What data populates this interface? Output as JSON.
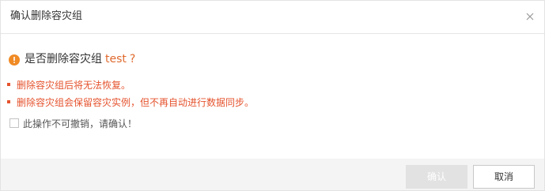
{
  "dialog": {
    "title": "确认删除容灾组",
    "close_icon": "close-icon"
  },
  "question": {
    "icon": "warning-icon",
    "prefix": "是否删除容灾组",
    "name": "test",
    "suffix": "?"
  },
  "warnings": [
    "删除容灾组后将无法恢复。",
    "删除容灾组会保留容灾实例，但不再自动进行数据同步。"
  ],
  "confirm": {
    "label": "此操作不可撤销，请确认！",
    "checked": false
  },
  "buttons": {
    "ok_label": "确认",
    "cancel_label": "取消"
  },
  "colors": {
    "warning": "#e5532e",
    "accent": "#e06a2f",
    "disabled_button": "#e2e2e2"
  }
}
